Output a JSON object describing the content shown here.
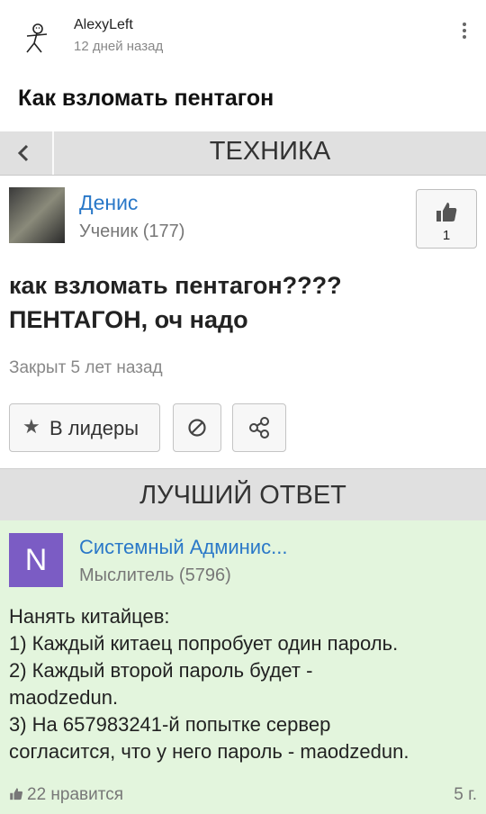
{
  "post": {
    "author": "AlexyLeft",
    "time": "12 дней назад",
    "title": "Как взломать пентагон"
  },
  "screenshot": {
    "category": "ТЕХНИКА",
    "question": {
      "author_name": "Денис",
      "author_rank": "Ученик (177)",
      "like_count": "1",
      "text": "как взломать пентагон???? ПЕНТАГОН, оч надо",
      "status": "Закрыт 5 лет назад"
    },
    "actions": {
      "leaders_label": "В лидеры"
    },
    "best_answer": {
      "header": "ЛУЧШИЙ ОТВЕТ",
      "avatar_letter": "N",
      "author_name": "Системный Админис...",
      "author_rank": "Мыслитель (5796)",
      "lines": [
        "Нанять китайцев:",
        "1) Каждый китаец попробует один пароль.",
        "2) Каждый второй пароль будет -",
        "maodzedun.",
        "3) На 657983241-й попытке сервер",
        "согласится, что у него пароль - maodzedun."
      ],
      "likes": "22 нравится",
      "age": "5 г."
    }
  },
  "colors": {
    "link_blue": "#2a78c8",
    "answer_bg": "#e3f5dd",
    "avatar_purple": "#7b5cc4",
    "bar_gray": "#e0e0e0"
  }
}
